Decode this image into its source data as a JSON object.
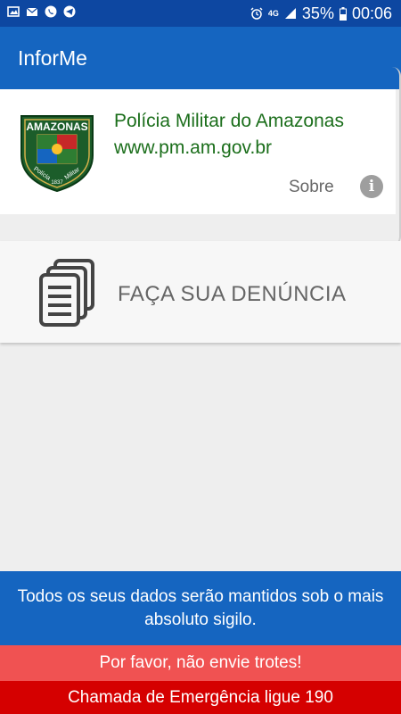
{
  "status_bar": {
    "battery_percent": "35%",
    "time": "00:06",
    "network": "4G",
    "icons": [
      "image-icon",
      "mail-icon",
      "phone-icon",
      "telegram-icon",
      "alarm-icon",
      "signal-icon",
      "battery-icon"
    ]
  },
  "app_bar": {
    "title": "InforMe"
  },
  "header": {
    "organization": "Polícia Militar do Amazonas",
    "website": "www.pm.am.gov.br",
    "about_label": "Sobre",
    "logo": {
      "top_text": "AMAZONAS",
      "left_text": "Polícia",
      "right_text": "Militar",
      "year": "1837"
    }
  },
  "report": {
    "label": "FAÇA SUA DENÚNCIA"
  },
  "footer": {
    "privacy_notice": "Todos os seus dados serão mantidos sob o mais absoluto sigilo.",
    "warning": "Por favor, não envie trotes!",
    "emergency": "Chamada de Emergência ligue 190"
  },
  "colors": {
    "status_bar": "#0d47a1",
    "app_bar": "#1565c0",
    "org_text": "#1b6e1b",
    "warning_bg": "#f05252",
    "emergency_bg": "#d50000"
  }
}
